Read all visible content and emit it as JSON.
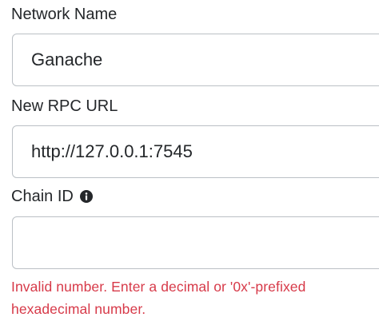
{
  "form": {
    "network_name": {
      "label": "Network Name",
      "value": "Ganache"
    },
    "rpc_url": {
      "label": "New RPC URL",
      "value": "http://127.0.0.1:7545"
    },
    "chain_id": {
      "label": "Chain ID",
      "value": "",
      "info_icon": "info-circle-icon",
      "error": "Invalid number. Enter a decimal or '0x'-prefixed hexadecimal number."
    }
  },
  "colors": {
    "text": "#24272a",
    "border": "#bbc0c5",
    "error": "#d73a49"
  }
}
